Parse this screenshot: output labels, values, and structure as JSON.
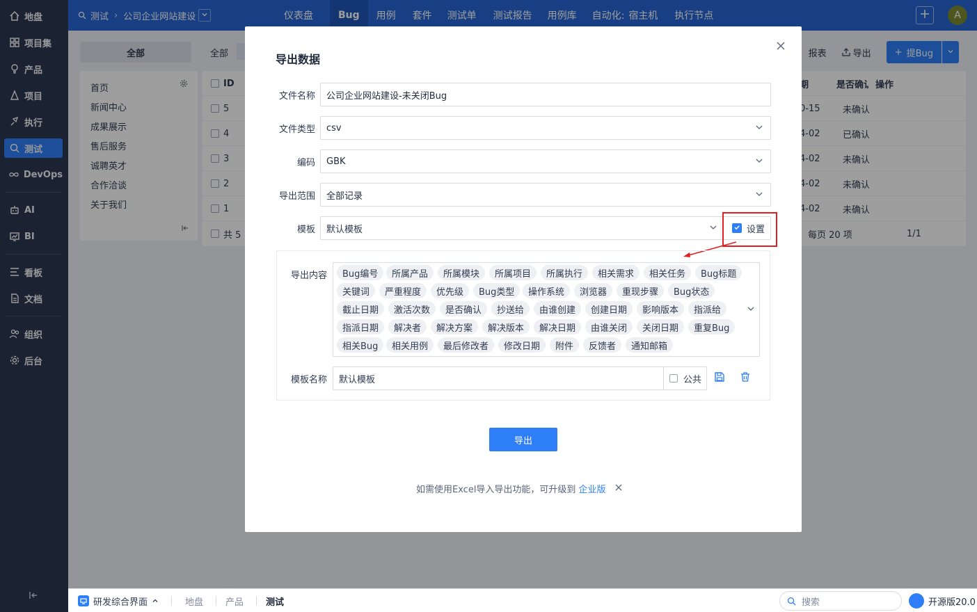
{
  "sidebar": {
    "items": [
      {
        "label": "地盘",
        "icon": "home-icon"
      },
      {
        "label": "项目集",
        "icon": "grid-icon"
      },
      {
        "label": "产品",
        "icon": "bulb-icon"
      },
      {
        "label": "项目",
        "icon": "project-icon"
      },
      {
        "label": "执行",
        "icon": "rocket-icon"
      },
      {
        "label": "测试",
        "icon": "magnifier-icon",
        "active": true
      },
      {
        "label": "DevOps",
        "icon": "infinity-icon"
      },
      {
        "label": "AI",
        "icon": "robot-icon"
      },
      {
        "label": "BI",
        "icon": "chart-icon"
      },
      {
        "label": "看板",
        "icon": "kanban-icon"
      },
      {
        "label": "文档",
        "icon": "doc-icon"
      },
      {
        "label": "组织",
        "icon": "people-icon"
      },
      {
        "label": "后台",
        "icon": "gear-icon"
      }
    ]
  },
  "header": {
    "crumb_module": "测试",
    "crumb_product": "公司企业网站建设",
    "nav": [
      "仪表盘",
      "Bug",
      "用例",
      "套件",
      "测试单",
      "测试报告",
      "用例库",
      "自动化:",
      "宿主机",
      "执行节点"
    ],
    "avatar_letter": "A"
  },
  "background": {
    "module_tab": "全部",
    "tree": [
      "首页",
      "新闻中心",
      "成果展示",
      "售后服务",
      "诚聘英才",
      "合作洽谈",
      "关于我们"
    ],
    "filter_all": "全部",
    "actions": {
      "report": "报表",
      "export": "导出",
      "create_bug": "提Bug"
    },
    "table": {
      "col_id": "ID",
      "col_date_tail": "期",
      "col_confirmed": "是否确认",
      "col_ops": "操作",
      "rows": [
        {
          "id": "5",
          "date": "0-15",
          "confirmed": "未确认"
        },
        {
          "id": "4",
          "date": "4-02",
          "confirmed": "已确认"
        },
        {
          "id": "3",
          "date": "4-02",
          "confirmed": "未确认"
        },
        {
          "id": "2",
          "date": "4-02",
          "confirmed": "未确认"
        },
        {
          "id": "1",
          "date": "4-02",
          "confirmed": "未确认"
        }
      ],
      "footer_total": "共 5",
      "per_page": "每页 20 项",
      "pager": "1/1"
    }
  },
  "modal": {
    "title": "导出数据",
    "file_name_label": "文件名称",
    "file_name_value": "公司企业网站建设-未关闭Bug",
    "file_type_label": "文件类型",
    "file_type_value": "csv",
    "encoding_label": "编码",
    "encoding_value": "GBK",
    "range_label": "导出范围",
    "range_value": "全部记录",
    "template_label": "模板",
    "template_value": "默认模板",
    "setting_label": "设置",
    "content_label": "导出内容",
    "fields": [
      [
        "Bug编号",
        "所属产品",
        "所属模块",
        "所属项目",
        "所属执行",
        "相关需求",
        "相关任务",
        "Bug标题"
      ],
      [
        "关键词",
        "严重程度",
        "优先级",
        "Bug类型",
        "操作系统",
        "浏览器",
        "重现步骤",
        "Bug状态"
      ],
      [
        "截止日期",
        "激活次数",
        "是否确认",
        "抄送给",
        "由谁创建",
        "创建日期",
        "影响版本",
        "指派给"
      ],
      [
        "指派日期",
        "解决者",
        "解决方案",
        "解决版本",
        "解决日期",
        "由谁关闭",
        "关闭日期",
        "重复Bug"
      ],
      [
        "相关Bug",
        "相关用例",
        "最后修改者",
        "修改日期",
        "附件",
        "反馈者",
        "通知邮箱"
      ]
    ],
    "template_name_label": "模板名称",
    "template_name_value": "默认模板",
    "public_label": "公共",
    "export_button": "导出",
    "notice_text": "如需使用Excel导入导出功能，可升级到",
    "notice_link": "企业版"
  },
  "bottombar": {
    "app": "研发综合界面",
    "crumbs": [
      "地盘",
      "产品",
      "测试"
    ],
    "search_placeholder": "搜索",
    "version": "开源版20.0"
  },
  "colors": {
    "primary": "#2e7ef7",
    "header": "#2766d4",
    "sidebar": "#2d3851",
    "highlight": "#e02020"
  }
}
